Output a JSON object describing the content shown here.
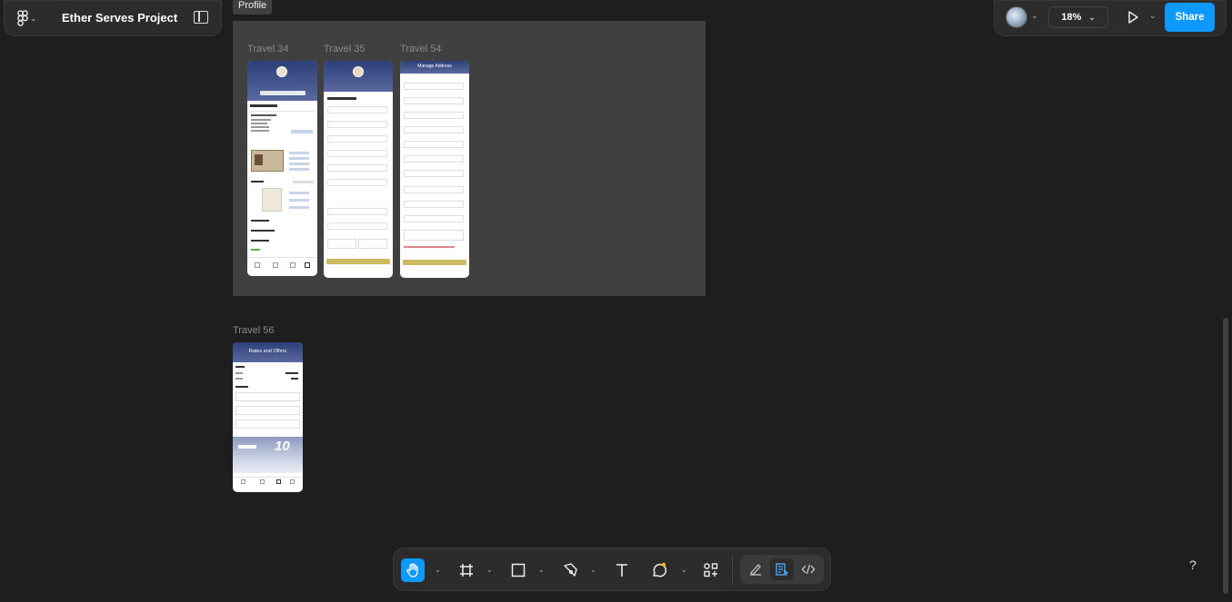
{
  "app": {
    "project_title": "Ether Serves Project",
    "zoom": "18%",
    "share_label": "Share",
    "accent": "#0d99ff"
  },
  "canvas": {
    "section_name": "Profile",
    "frames": [
      {
        "label": "Travel 34"
      },
      {
        "label": "Travel 35"
      },
      {
        "label": "Travel 54",
        "header_title": "Manage Address"
      },
      {
        "label": "Travel 56",
        "header_title": "Rates and Offers",
        "promo_value": "10"
      }
    ]
  },
  "toolbar": {
    "tools": [
      "hand-tool",
      "frame-tool",
      "shape-tool",
      "pen-tool",
      "text-tool",
      "comment-tool",
      "actions-tool"
    ],
    "active_tool": "hand-tool"
  },
  "help": "?"
}
